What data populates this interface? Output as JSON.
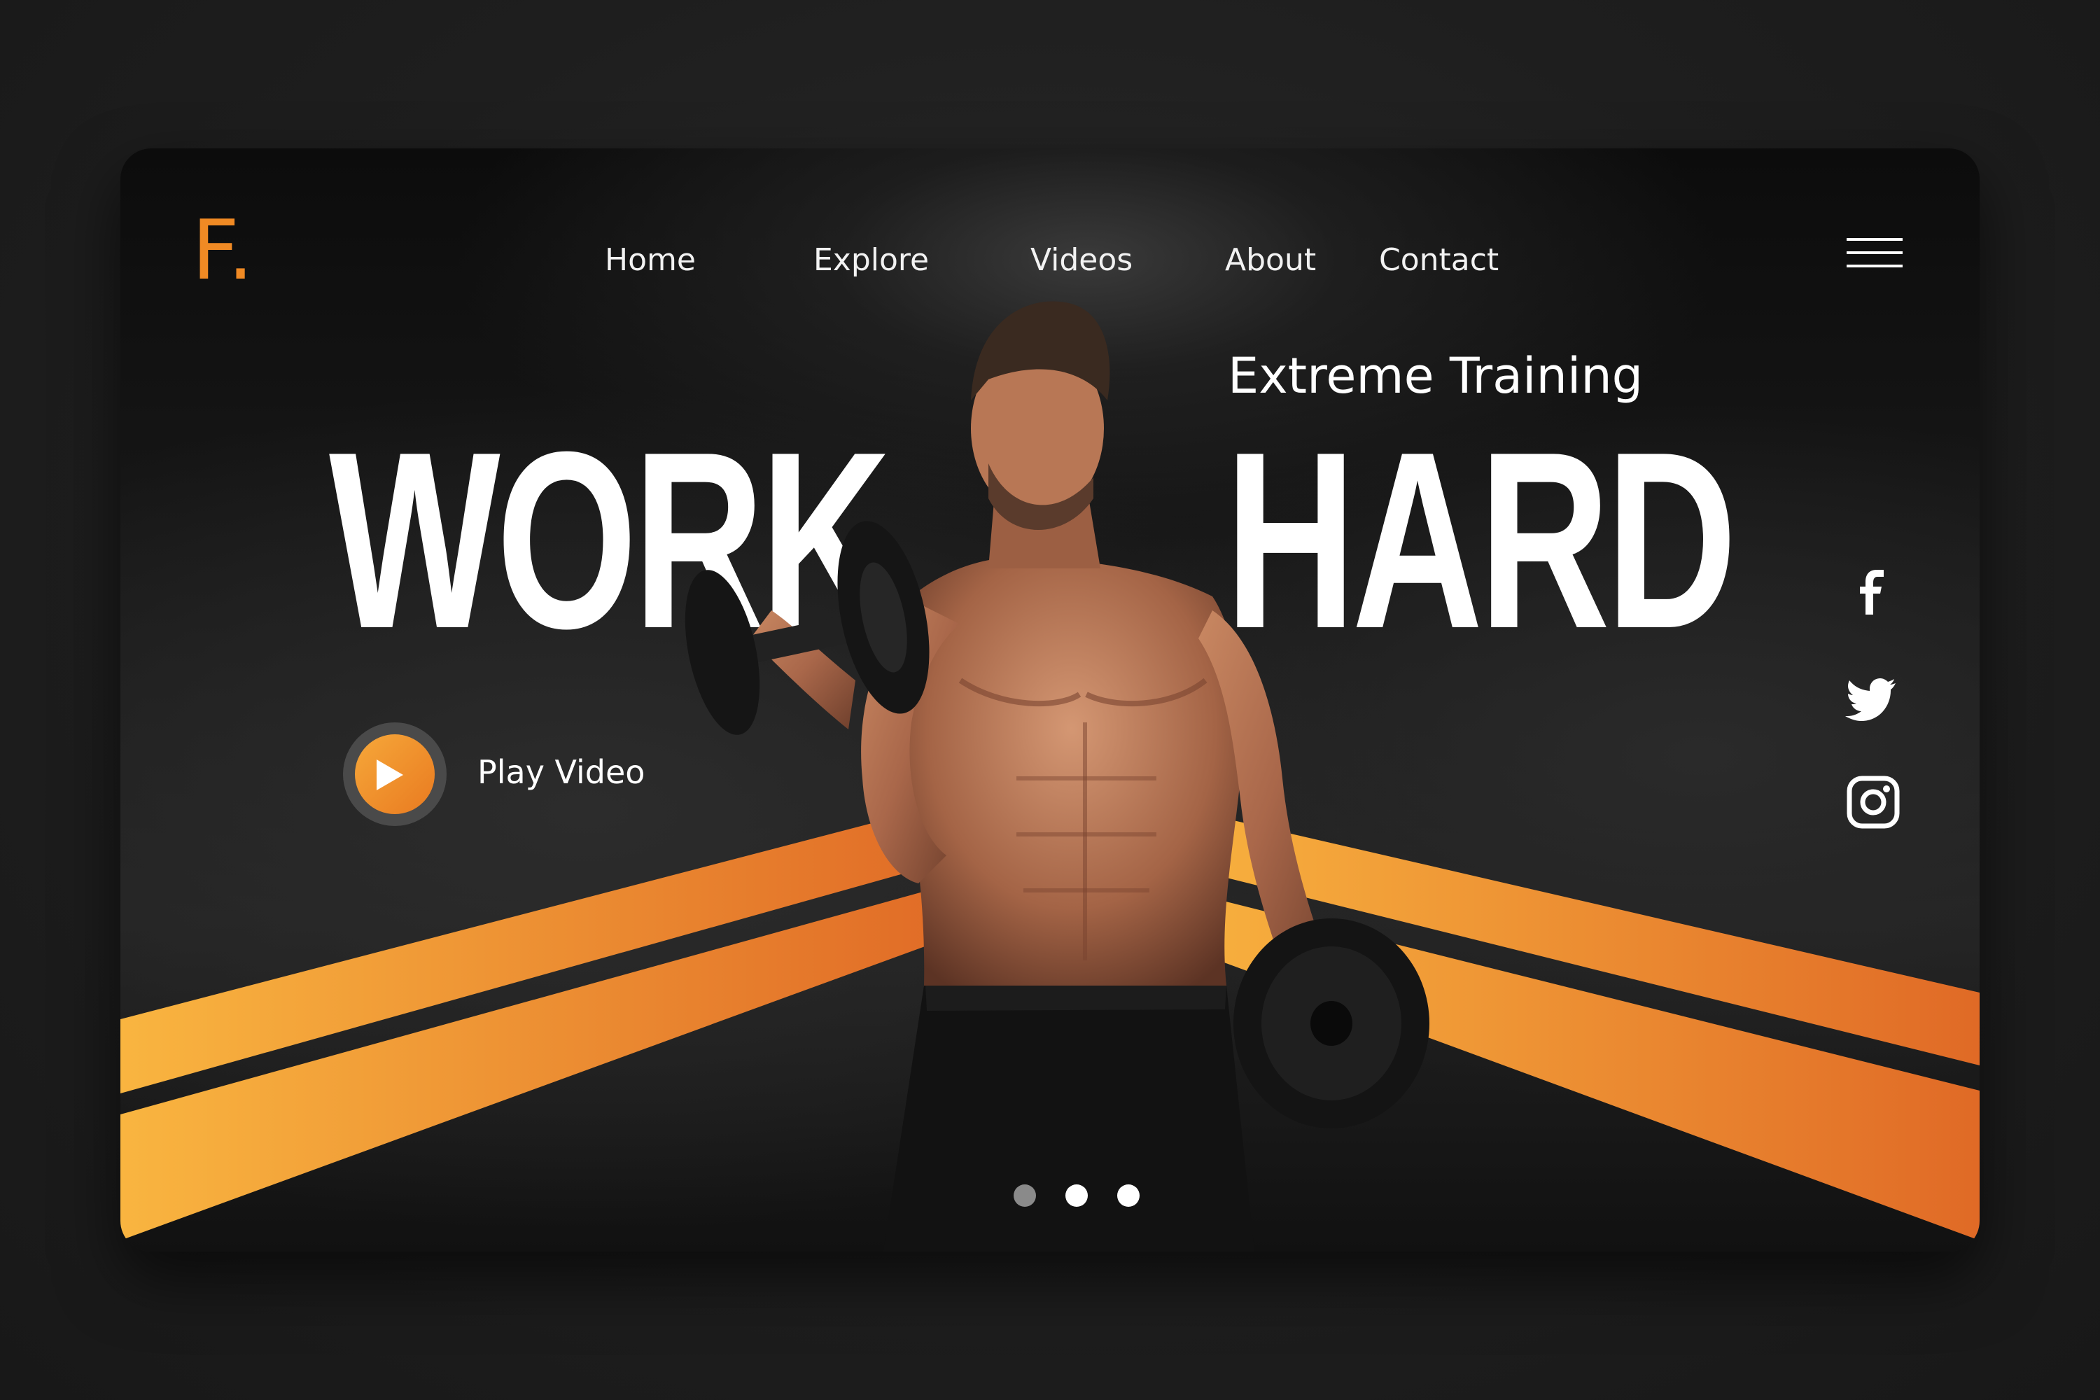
{
  "brand": {
    "logo_text": "F.",
    "accent_color": "#f08a24"
  },
  "nav": {
    "items": [
      {
        "label": "Home"
      },
      {
        "label": "Explore"
      },
      {
        "label": "Videos"
      },
      {
        "label": "About"
      },
      {
        "label": "Contact"
      }
    ],
    "menu_icon": "hamburger-menu-icon"
  },
  "hero": {
    "subtitle": "Extreme Training",
    "headline_left": "WORK",
    "headline_right": "HARD",
    "play_label": "Play Video",
    "play_icon": "play-icon",
    "image": "athlete-with-dumbbells"
  },
  "social": [
    {
      "name": "facebook",
      "icon": "facebook-icon"
    },
    {
      "name": "twitter",
      "icon": "twitter-icon"
    },
    {
      "name": "instagram",
      "icon": "instagram-icon"
    }
  ],
  "carousel": {
    "count": 3,
    "active_index": 0
  },
  "colors": {
    "stripe_start": "#f9b540",
    "stripe_end": "#e06a26",
    "background": "#1d1d1d",
    "text": "#ffffff"
  }
}
